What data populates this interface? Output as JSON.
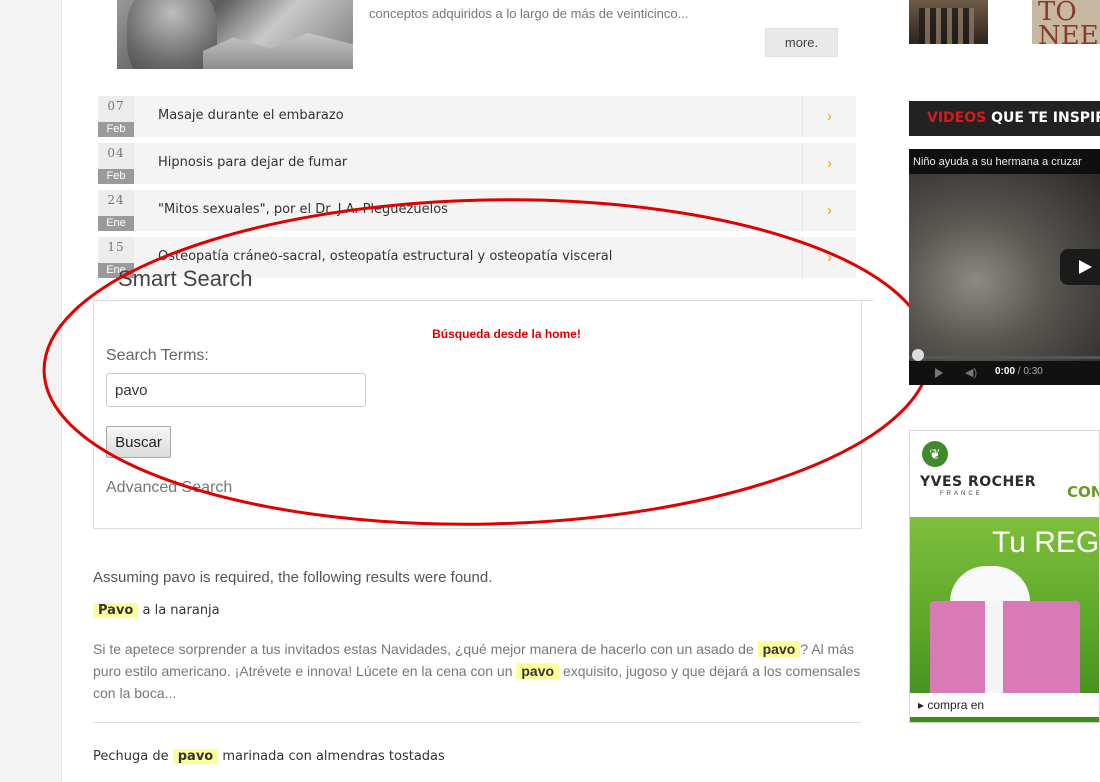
{
  "teaser": {
    "text": "conceptos adquiridos a lo largo de más de veinticinco...",
    "more_label": "more."
  },
  "events": [
    {
      "day": "07",
      "month": "Feb",
      "title": "Masaje durante el embarazo",
      "arrow": "›"
    },
    {
      "day": "04",
      "month": "Feb",
      "title": "Hipnosis para dejar de fumar",
      "arrow": "›"
    },
    {
      "day": "24",
      "month": "Ene",
      "title": "\"Mitos sexuales\", por el Dr. J.A. Pleguezuelos",
      "arrow": "›"
    },
    {
      "day": "15",
      "month": "Ene",
      "title": "Osteopatía cráneo-sacral, osteopatía estructural y osteopatía visceral",
      "arrow": "›"
    }
  ],
  "smart_search": {
    "title": "Smart Search",
    "alert": "Búsqueda desde la home!",
    "terms_label": "Search Terms:",
    "terms_value": "pavo",
    "button_label": "Buscar",
    "advanced_label": "Advanced Search"
  },
  "results": {
    "summary": "Assuming pavo is required, the following results were found.",
    "items": [
      {
        "pre": "",
        "hl": "Pavo",
        "post": " a la naranja",
        "snippet_1": "Si te apetece sorprender a tus invitados estas Navidades, ¿qué mejor manera de hacerlo con un asado de ",
        "snippet_hl1": "pavo",
        "snippet_2": "? Al más puro estilo americano. ¡Atrévete e innova! Lúcete en la cena con un ",
        "snippet_hl2": "pavo",
        "snippet_3": " exquisito, jugoso y que dejará a los comensales con la boca..."
      },
      {
        "pre": "Pechuga de ",
        "hl": "pavo",
        "post": " marinada con almendras tostadas"
      }
    ]
  },
  "sidebar": {
    "thumb2_text": "TO NEE",
    "videos_head_accent": "VIDEOS",
    "videos_head_rest": " QUE TE INSPIRAN",
    "video_title": "Niño ayuda a su hermana a cruzar",
    "video_time_current": "0:00",
    "video_time_total": " / 0:30",
    "ad_brand": "YVES ROCHER",
    "ad_brand_sub": "FRANCE",
    "ad_con": "CON",
    "ad_headline": "Tu REGALO",
    "ad_cta": "▸ compra en"
  },
  "colors": {
    "accent_red": "#d21b1b",
    "highlight": "#ffff99",
    "arrow_orange": "#f0a400"
  }
}
